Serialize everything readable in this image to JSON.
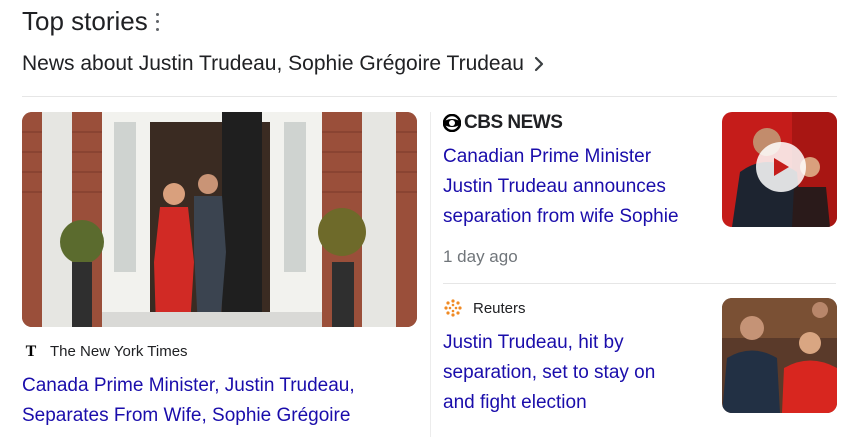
{
  "header": {
    "title": "Top stories",
    "subtitle": "News about Justin Trudeau, Sophie Grégoire Trudeau"
  },
  "stories": [
    {
      "publisher": "The New York Times",
      "headline_line1": "Canada Prime Minister, Justin Trudeau,",
      "headline_line2": "Separates From Wife, Sophie Grégoire"
    },
    {
      "publisher": "CBS NEWS",
      "headline_line1": "Canadian Prime Minister",
      "headline_line2": "Justin Trudeau announces",
      "headline_line3": "separation from wife Sophie",
      "time": "1 day ago"
    },
    {
      "publisher": "Reuters",
      "headline_line1": "Justin Trudeau, hit by",
      "headline_line2": "separation, set to stay on",
      "headline_line3": "and fight election"
    }
  ],
  "icons": {
    "more": "more-vert-icon",
    "chevron": "chevron-right-icon",
    "play": "play-icon"
  },
  "colors": {
    "link": "#1a0dab",
    "text": "#202124",
    "muted": "#70757a"
  }
}
